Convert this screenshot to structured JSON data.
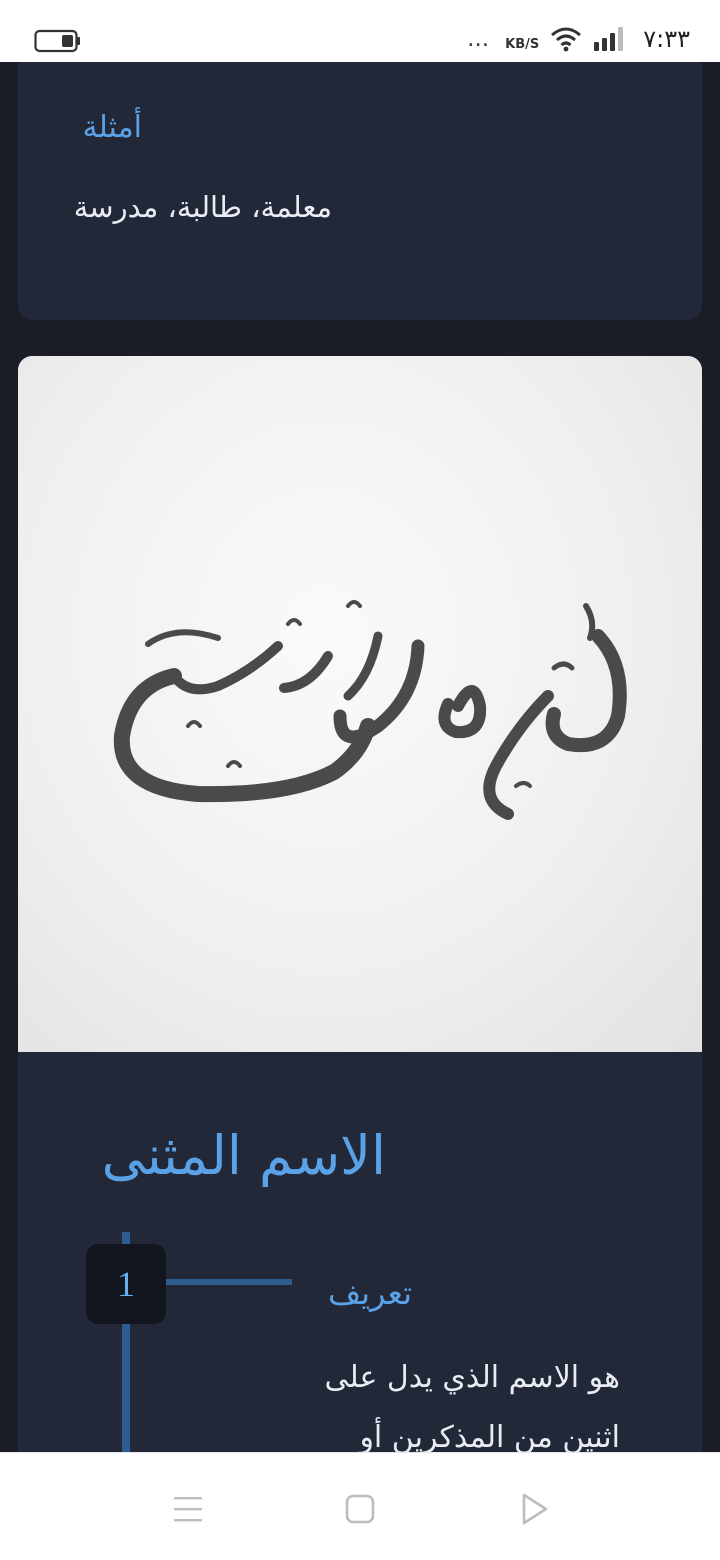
{
  "status_bar": {
    "time": "٧:٣٣",
    "speed_unit": "KB/S",
    "dots": "…"
  },
  "examples_card": {
    "label": "أمثلة",
    "text": "معلمة، طالبة، مدرسة"
  },
  "dual_card": {
    "section_title": "الاسم المثنى",
    "step": {
      "number": "1",
      "title": "تعريف",
      "body": "هو الاسم الذي يدل على اثنين من المذكرين أو"
    }
  },
  "colors": {
    "accent": "#5aa2e8",
    "card_bg": "#232838",
    "page_bg": "#1a1d26",
    "timeline": "#2d5c91"
  },
  "icons": [
    "battery-icon",
    "wifi-icon",
    "signal-icon",
    "menu-icon",
    "home-icon",
    "back-icon"
  ]
}
